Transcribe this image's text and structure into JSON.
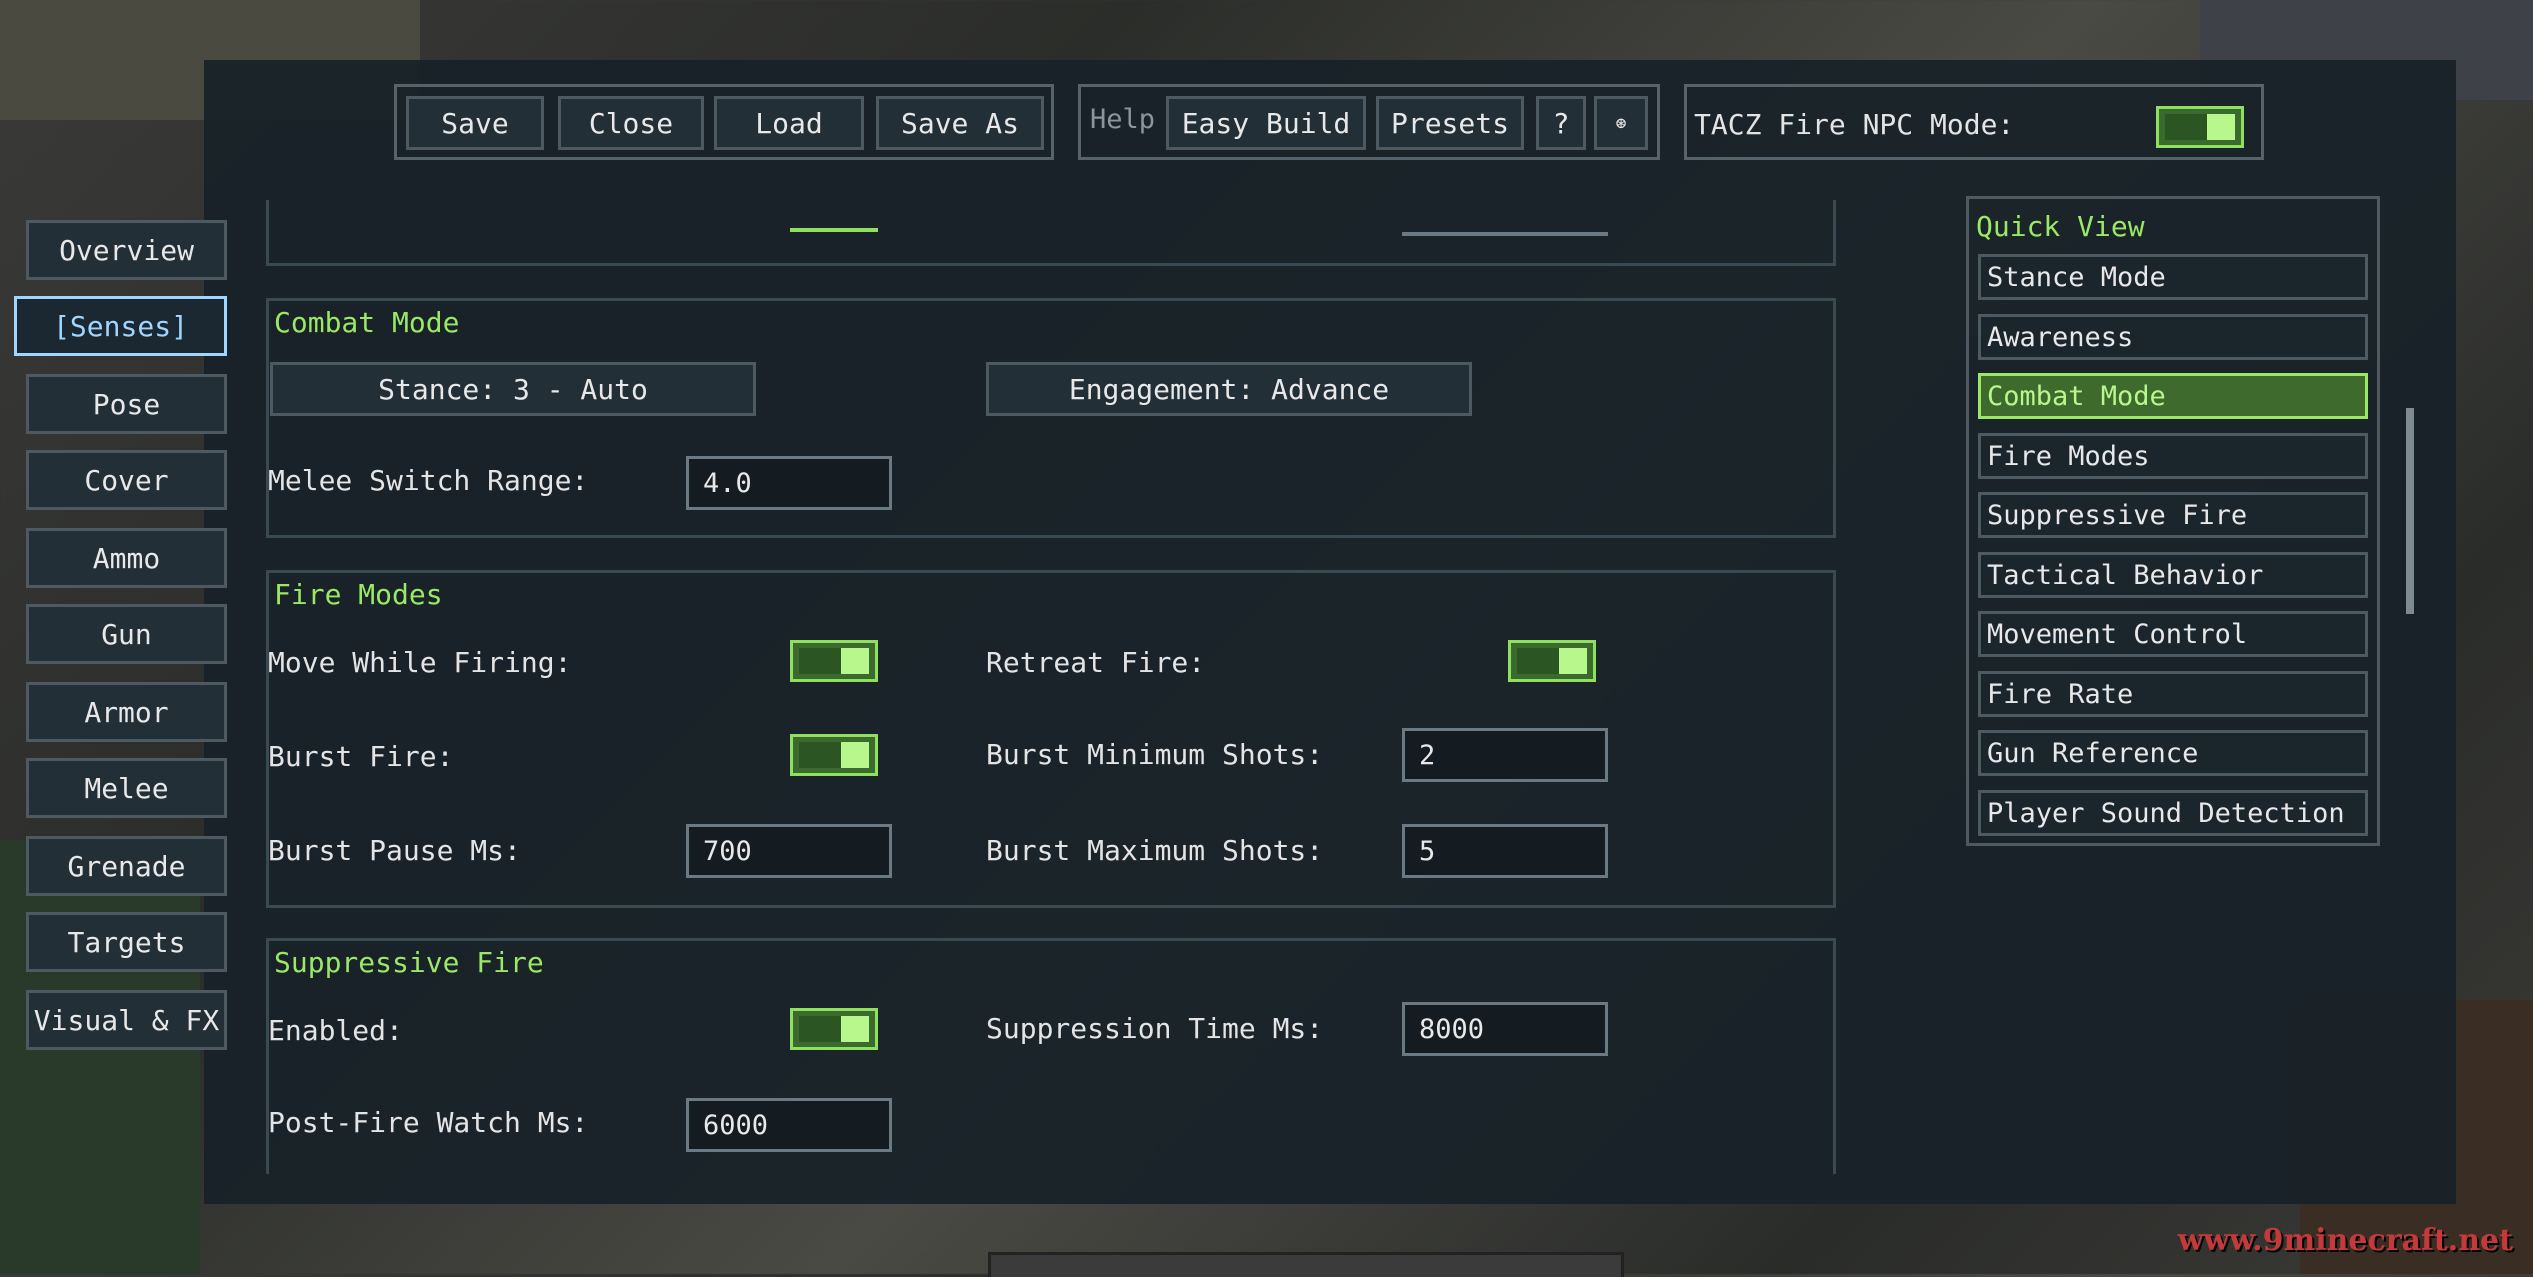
{
  "toolbar": {
    "save": "Save",
    "close": "Close",
    "load": "Load",
    "save_as": "Save As",
    "help": "Help",
    "easy_build": "Easy Build",
    "presets": "Presets",
    "question": "?",
    "settings_glyph": "⊛",
    "npc_mode_label": "TACZ Fire NPC Mode:"
  },
  "sidebar": {
    "items": [
      {
        "label": "Overview"
      },
      {
        "label": "[Senses]"
      },
      {
        "label": "Pose"
      },
      {
        "label": "Cover"
      },
      {
        "label": "Ammo"
      },
      {
        "label": "Gun"
      },
      {
        "label": "Armor"
      },
      {
        "label": "Melee"
      },
      {
        "label": "Grenade"
      },
      {
        "label": "Targets"
      },
      {
        "label": "Visual & FX"
      }
    ]
  },
  "combat_mode": {
    "title": "Combat Mode",
    "stance_button": "Stance: 3 - Auto",
    "engagement_button": "Engagement: Advance",
    "melee_switch_label": "Melee Switch Range:",
    "melee_switch_value": "4.0"
  },
  "fire_modes": {
    "title": "Fire Modes",
    "move_while_firing_label": "Move While Firing:",
    "retreat_fire_label": "Retreat Fire:",
    "burst_fire_label": "Burst Fire:",
    "burst_min_label": "Burst Minimum Shots:",
    "burst_min_value": "2",
    "burst_pause_label": "Burst Pause Ms:",
    "burst_pause_value": "700",
    "burst_max_label": "Burst Maximum Shots:",
    "burst_max_value": "5"
  },
  "suppressive_fire": {
    "title": "Suppressive Fire",
    "enabled_label": "Enabled:",
    "suppression_time_label": "Suppression Time Ms:",
    "suppression_time_value": "8000",
    "post_fire_label": "Post-Fire Watch Ms:",
    "post_fire_value": "6000"
  },
  "quick_view": {
    "title": "Quick View",
    "items": [
      {
        "label": "Stance Mode"
      },
      {
        "label": "Awareness"
      },
      {
        "label": "Combat Mode"
      },
      {
        "label": "Fire Modes"
      },
      {
        "label": "Suppressive Fire"
      },
      {
        "label": "Tactical Behavior"
      },
      {
        "label": "Movement Control"
      },
      {
        "label": "Fire Rate"
      },
      {
        "label": "Gun Reference"
      },
      {
        "label": "Player Sound Detection"
      }
    ]
  },
  "watermark": "www.9minecraft.net",
  "colors": {
    "accent_green": "#9ae865",
    "toggle_on": "#b8f78c",
    "panel_bg": "#182128"
  }
}
